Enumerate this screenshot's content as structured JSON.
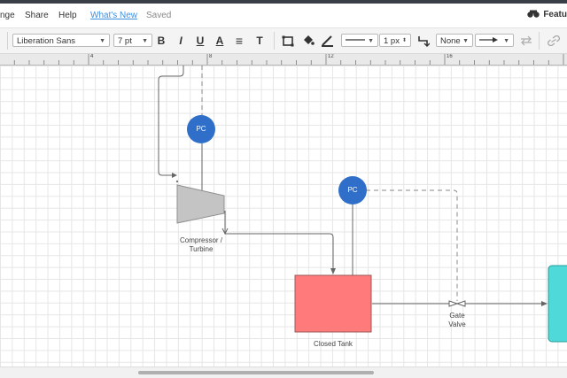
{
  "menu": {
    "items": [
      "nge",
      "Share",
      "Help",
      "What's New",
      "Saved"
    ],
    "feature_label": "Featu"
  },
  "toolbar": {
    "font_family": "Liberation Sans",
    "font_size": "7 pt",
    "bold": "B",
    "italic": "I",
    "underline": "U",
    "text_color": "A",
    "align": "≡",
    "text_options": "T",
    "line_width": "1 px",
    "arrow_start": "None"
  },
  "ruler": {
    "ticks": [
      "4",
      "8",
      "12",
      "16"
    ]
  },
  "diagram": {
    "pc1_label": "PC",
    "pc2_label": "PC",
    "compressor_label_1": "Compressor /",
    "compressor_label_2": "Turbine",
    "tank_label": "Closed Tank",
    "valve_label_1": "Gate",
    "valve_label_2": "Valve"
  },
  "colors": {
    "pc_fill": "#2f6fca",
    "tank_fill": "#ff7b7b",
    "compressor_fill": "#c4c4c4",
    "cyan_shape": "#4fd9d9",
    "accent": "#3d8fe0"
  }
}
